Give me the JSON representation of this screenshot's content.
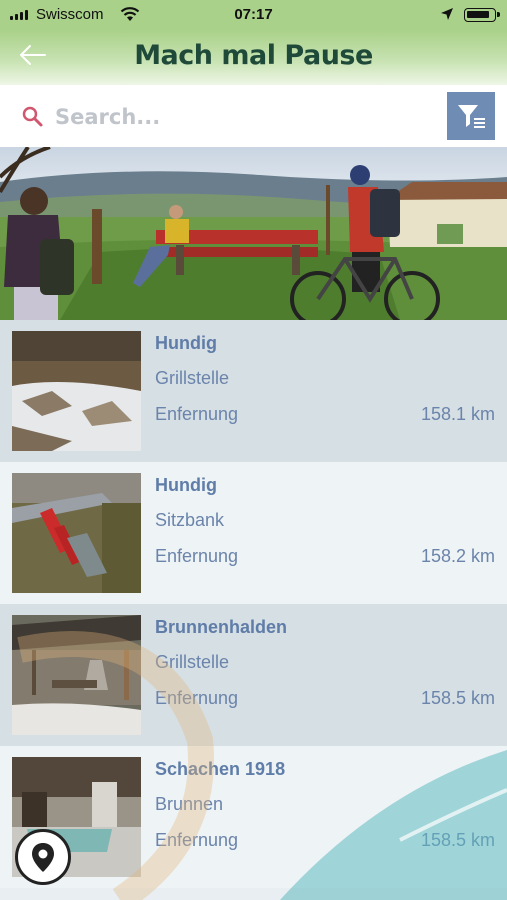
{
  "status_bar": {
    "carrier": "Swisscom",
    "time": "07:17"
  },
  "header": {
    "title": "Mach mal Pause",
    "back_icon": "back-arrow-icon"
  },
  "search": {
    "placeholder": "Search...",
    "filter_icon": "filter-icon"
  },
  "colors": {
    "header_green": "#a9d189",
    "title": "#1f4a3a",
    "accent_blue": "#6f8db4",
    "text_blue": "#6b84ab"
  },
  "places": [
    {
      "name": "Hundig",
      "type": "Grillstelle",
      "distance_label": "Enfernung",
      "distance": "158.1 km"
    },
    {
      "name": "Hundig",
      "type": "Sitzbank",
      "distance_label": "Enfernung",
      "distance": "158.2 km"
    },
    {
      "name": "Brunnenhalden",
      "type": "Grillstelle",
      "distance_label": "Enfernung",
      "distance": "158.5 km"
    },
    {
      "name": "Schachen 1918",
      "type": "Brunnen",
      "distance_label": "Enfernung",
      "distance": "158.5 km"
    }
  ],
  "map_button_icon": "location-pin-icon"
}
